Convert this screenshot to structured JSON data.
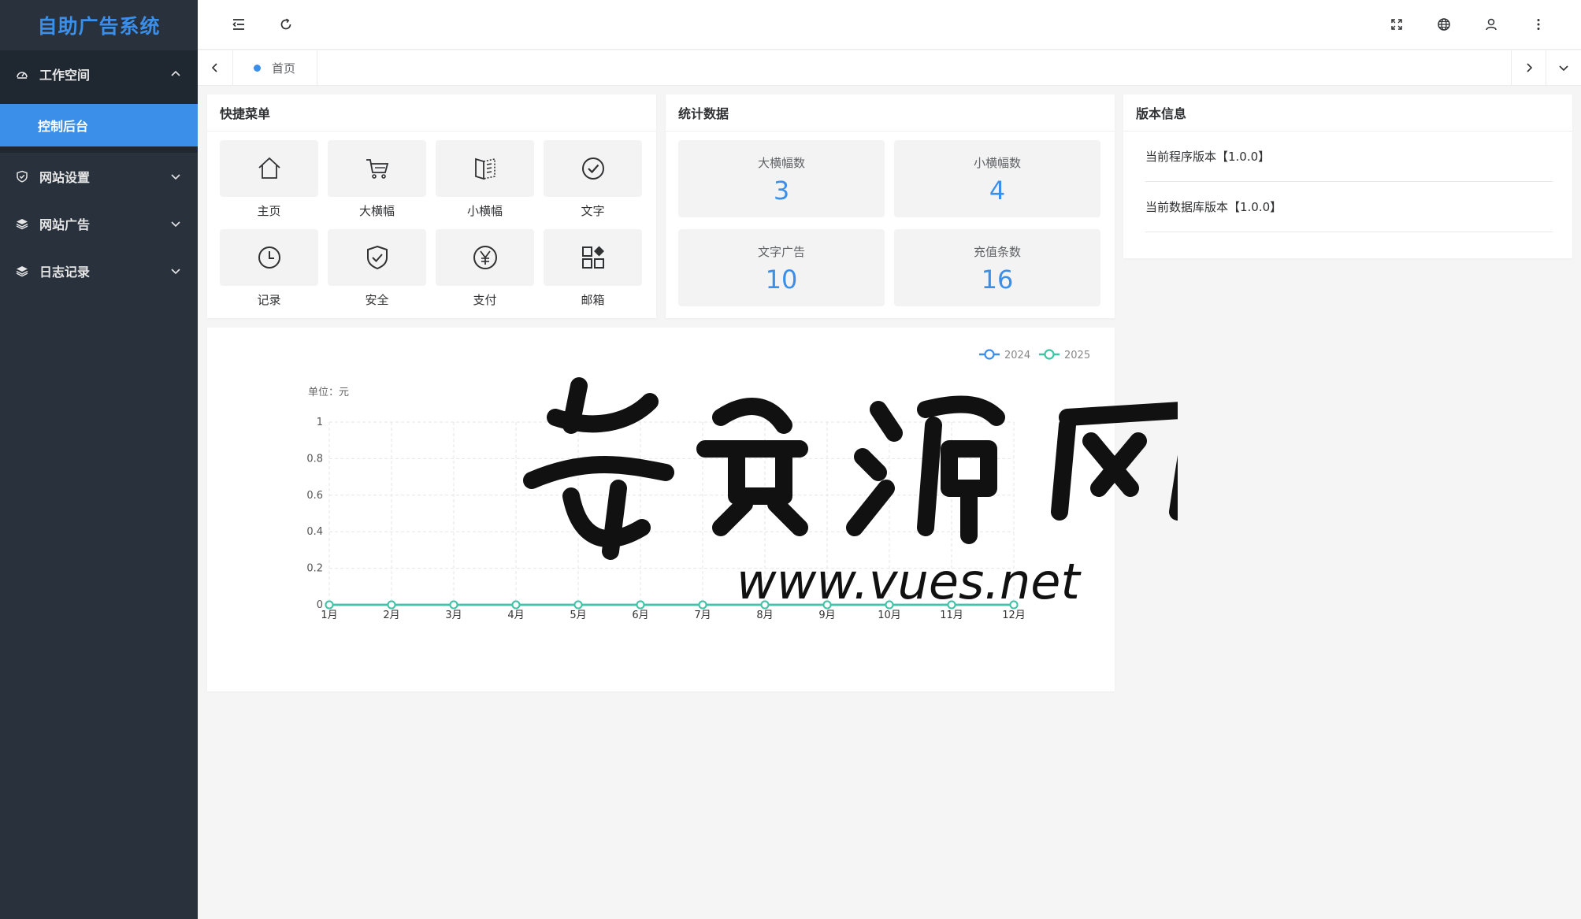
{
  "app": {
    "title": "自助广告系统"
  },
  "sidebar": {
    "items": [
      {
        "label": "工作空间",
        "icon": "dashboard-icon",
        "expanded": true
      },
      {
        "label": "网站设置",
        "icon": "shield-icon",
        "expanded": false
      },
      {
        "label": "网站广告",
        "icon": "layers-icon",
        "expanded": false
      },
      {
        "label": "日志记录",
        "icon": "layers-icon",
        "expanded": false
      }
    ],
    "active_sub_item": "控制后台"
  },
  "topbar": {
    "icons": [
      "collapse-menu-icon",
      "refresh-icon",
      "fullscreen-icon",
      "globe-icon",
      "user-icon",
      "more-icon"
    ]
  },
  "tabs": [
    {
      "label": "首页",
      "active": true
    }
  ],
  "quick_menu": {
    "title": "快捷菜单",
    "items": [
      {
        "label": "主页",
        "icon": "home-icon"
      },
      {
        "label": "大横幅",
        "icon": "cart-icon"
      },
      {
        "label": "小横幅",
        "icon": "book-icon"
      },
      {
        "label": "文字",
        "icon": "check-circle-icon"
      },
      {
        "label": "记录",
        "icon": "clock-icon"
      },
      {
        "label": "安全",
        "icon": "shield-check-icon"
      },
      {
        "label": "支付",
        "icon": "yen-icon"
      },
      {
        "label": "邮箱",
        "icon": "apps-icon"
      }
    ]
  },
  "stats": {
    "title": "统计数据",
    "items": [
      {
        "label": "大横幅数",
        "value": "3"
      },
      {
        "label": "小横幅数",
        "value": "4"
      },
      {
        "label": "文字广告",
        "value": "10"
      },
      {
        "label": "充值条数",
        "value": "16"
      }
    ]
  },
  "version": {
    "title": "版本信息",
    "program": "当前程序版本【1.0.0】",
    "database": "当前数据库版本【1.0.0】"
  },
  "watermark": {
    "url": "www.vues.net"
  },
  "colors": {
    "accent": "#3b8fe8",
    "sidebar_bg": "#28313c",
    "series_2024": "#3b8fe8",
    "series_2025": "#3fc5a3"
  },
  "chart_data": {
    "type": "line",
    "unit_label": "单位：元",
    "categories": [
      "1月",
      "2月",
      "3月",
      "4月",
      "5月",
      "6月",
      "7月",
      "8月",
      "9月",
      "10月",
      "11月",
      "12月"
    ],
    "series": [
      {
        "name": "2024",
        "values": [
          0,
          0,
          0,
          0,
          0,
          0,
          0,
          0,
          0,
          0,
          0,
          0
        ],
        "color": "#3b8fe8"
      },
      {
        "name": "2025",
        "values": [
          0,
          0,
          0,
          0,
          0,
          0,
          0,
          0,
          0,
          0,
          0,
          0
        ],
        "color": "#3fc5a3"
      }
    ],
    "y_ticks": [
      "0",
      "0.2",
      "0.4",
      "0.6",
      "0.8",
      "1"
    ],
    "ylim": [
      0,
      1
    ],
    "grid": true,
    "legend_position": "top-right"
  }
}
